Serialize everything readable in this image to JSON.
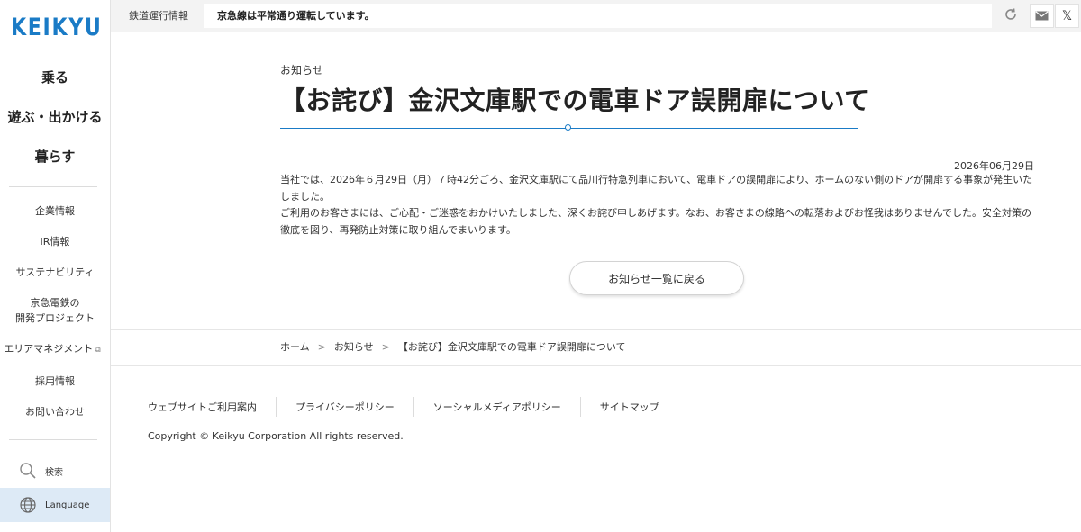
{
  "brand": {
    "logo_text": "KEIKYU",
    "accent": "#1a7bc6"
  },
  "sidebar": {
    "main_items": [
      {
        "label": "乗る"
      },
      {
        "label": "遊ぶ・出かける"
      },
      {
        "label": "暮らす"
      }
    ],
    "sub_items": [
      {
        "label": "企業情報"
      },
      {
        "label": "IR情報"
      },
      {
        "label": "サステナビリティ"
      },
      {
        "label_line1": "京急電鉄の",
        "label_line2": "開発プロジェクト"
      },
      {
        "label": "エリアマネジメント",
        "external_icon": "external-link-icon"
      },
      {
        "label": "採用情報"
      },
      {
        "label": "お問い合わせ"
      }
    ],
    "search": {
      "label": "検索",
      "icon": "search-icon"
    },
    "language": {
      "label": "Language",
      "icon": "globe-icon",
      "highlight": "#ddeaf6"
    }
  },
  "topbar": {
    "label": "鉄道運行情報",
    "status": "京急線は平常通り運転しています。",
    "icons": [
      "refresh-icon",
      "mail-icon",
      "x-icon"
    ],
    "x_glyph": "𝕏"
  },
  "article": {
    "category": "お知らせ",
    "title": "【お詫び】金沢文庫駅での電車ドア誤開扉について",
    "date": "2026年06月29日",
    "paragraph1": "当社では、2026年６月29日（月）７時42分ごろ、金沢文庫駅にて品川行特急列車において、電車ドアの誤開扉により、ホームのない側のドアが開扉する事象が発生いたしました。",
    "paragraph2": "ご利用のお客さまには、ご心配・ご迷惑をおかけいたしました、深くお詫び申しあげます。なお、お客さまの線路への転落およびお怪我はありませんでした。安全対策の徹底を図り、再発防止対策に取り組んでまいります。",
    "back_button": "お知らせ一覧に戻る"
  },
  "breadcrumb": {
    "items": [
      "ホーム",
      "お知らせ",
      "【お詫び】金沢文庫駅での電車ドア誤開扉について"
    ],
    "separator": ">"
  },
  "footer": {
    "links": [
      "ウェブサイトご利用案内",
      "プライバシーポリシー",
      "ソーシャルメディアポリシー",
      "サイトマップ"
    ],
    "copyright": "Copyright © Keikyu Corporation All rights reserved."
  }
}
